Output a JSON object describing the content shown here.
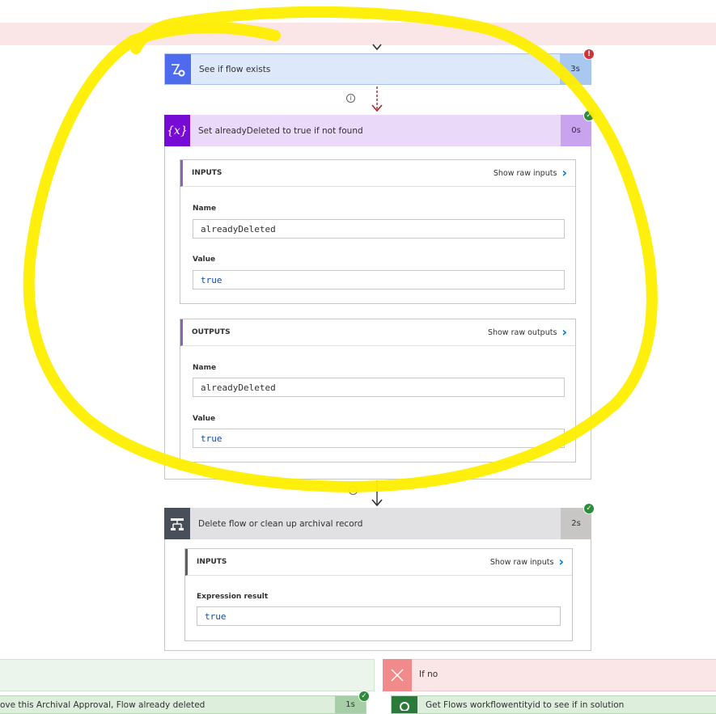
{
  "actions": [
    {
      "title": "See if flow exists",
      "duration": "3s",
      "status": "error",
      "icon": "bot-icon"
    },
    {
      "title": "Set alreadyDeleted to true if not found",
      "duration": "0s",
      "status": "success",
      "icon": "variable-icon",
      "icon_text": "{x}"
    },
    {
      "title": "Delete flow or clean up archival record",
      "duration": "2s",
      "status": "success",
      "icon": "condition-icon"
    }
  ],
  "set_variable": {
    "inputs": {
      "header": "INPUTS",
      "show_raw": "Show raw inputs",
      "name_label": "Name",
      "name_value": "alreadyDeleted",
      "value_label": "Value",
      "value_value": "true"
    },
    "outputs": {
      "header": "OUTPUTS",
      "show_raw": "Show raw outputs",
      "name_label": "Name",
      "name_value": "alreadyDeleted",
      "value_label": "Value",
      "value_value": "true"
    }
  },
  "condition": {
    "inputs": {
      "header": "INPUTS",
      "show_raw": "Show raw inputs",
      "expr_label": "Expression result",
      "expr_value": "true"
    }
  },
  "branches": {
    "yes_action_title": "ove this Archival Approval, Flow already deleted",
    "yes_action_duration": "1s",
    "no_label": "If no",
    "no_action_title": "Get Flows workflowentityid to see if in solution"
  },
  "badges": {
    "success": "✓",
    "error": "!"
  },
  "colors": {
    "accent_blue": "#0078d4",
    "error_red": "#d13438",
    "success_green": "#2e8b3a",
    "annotation_yellow": "#ffee00"
  }
}
